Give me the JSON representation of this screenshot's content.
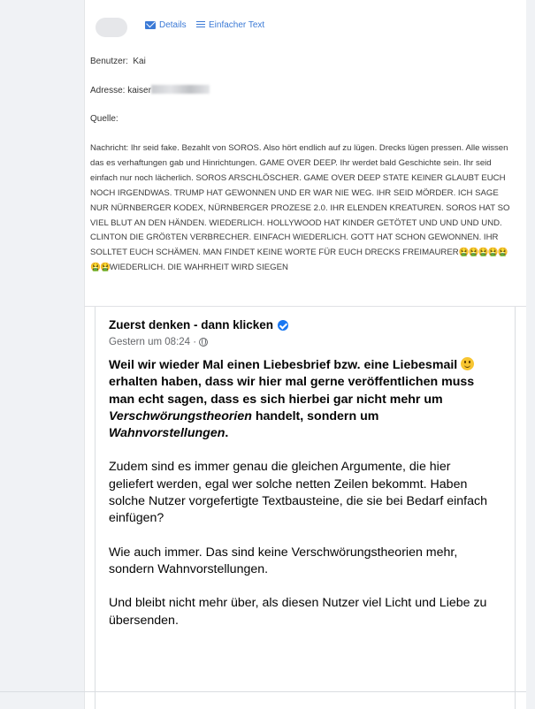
{
  "email": {
    "details_label": "Details",
    "plain_text_label": "Einfacher Text",
    "user_label": "Benutzer:",
    "user_value": "Kai",
    "address_label": "Adresse:",
    "address_value": "kaiser",
    "source_label": "Quelle:",
    "message_label": "Nachricht:",
    "message_text": "Ihr seid fake. Bezahlt von SOROS. Also hört endlich auf zu lügen. Drecks lügen pressen. Alle wissen das es verhaftungen gab und Hinrichtungen. GAME OVER DEEP. Ihr werdet bald Geschichte sein. Ihr seid einfach nur noch lächerlich. SOROS ARSCHLÖSCHER. GAME OVER DEEP STATE KEINER GLAUBT EUCH NOCH IRGENDWAS. TRUMP HAT GEWONNEN UND ER WAR NIE WEG. IHR SEID MÖRDER. ICH SAGE NUR NÜRNBERGER KODEX, NÜRNBERGER PROZESE 2.0. IHR ELENDEN KREATUREN. SOROS HAT SO VIEL BLUT AN DEN HÄNDEN. WIEDERLICH. HOLLYWOOD HAT KINDER GETÖTET UND UND UND UND. CLINTON DIE GRÖßTEN VERBRECHER. EINFACH WIEDERLICH. GOTT HAT SCHON GEWONNEN. IHR SOLLTET EUCH SCHÄMEN. MAN FINDET KEINE WORTE FÜR EUCH DRECKS FREIMAURER",
    "message_emojis": "🤮🤮🤮🤮🤮🤮🤮",
    "message_tail": "WIEDERLICH. DIE WAHRHEIT WIRD SIEGEN"
  },
  "post": {
    "author": "Zuerst denken - dann klicken",
    "timestamp": "Gestern um 08:24 ·",
    "lead_part1": "Weil wir wieder Mal einen Liebesbrief bzw. eine Liebesmail",
    "lead_part2": "erhalten haben, dass wir hier mal gerne veröffentlichen muss man echt sagen, dass es sich hierbei gar nicht mehr um",
    "lead_italic1": "Verschwörungstheorien",
    "lead_part3": "handelt, sondern um",
    "lead_italic2": "Wahnvorstellungen",
    "lead_end": ".",
    "para2": "Zudem sind es immer genau die gleichen Argumente, die hier geliefert werden, egal wer solche netten Zeilen bekommt. Haben solche Nutzer vorgefertigte Textbausteine, die sie bei Bedarf einfach einfügen?",
    "para3": "Wie auch immer. Das sind keine Verschwörungstheorien mehr, sondern Wahnvorstellungen.",
    "para4": "Und bleibt nicht mehr über, als diesen Nutzer viel Licht und Liebe zu übersenden."
  }
}
